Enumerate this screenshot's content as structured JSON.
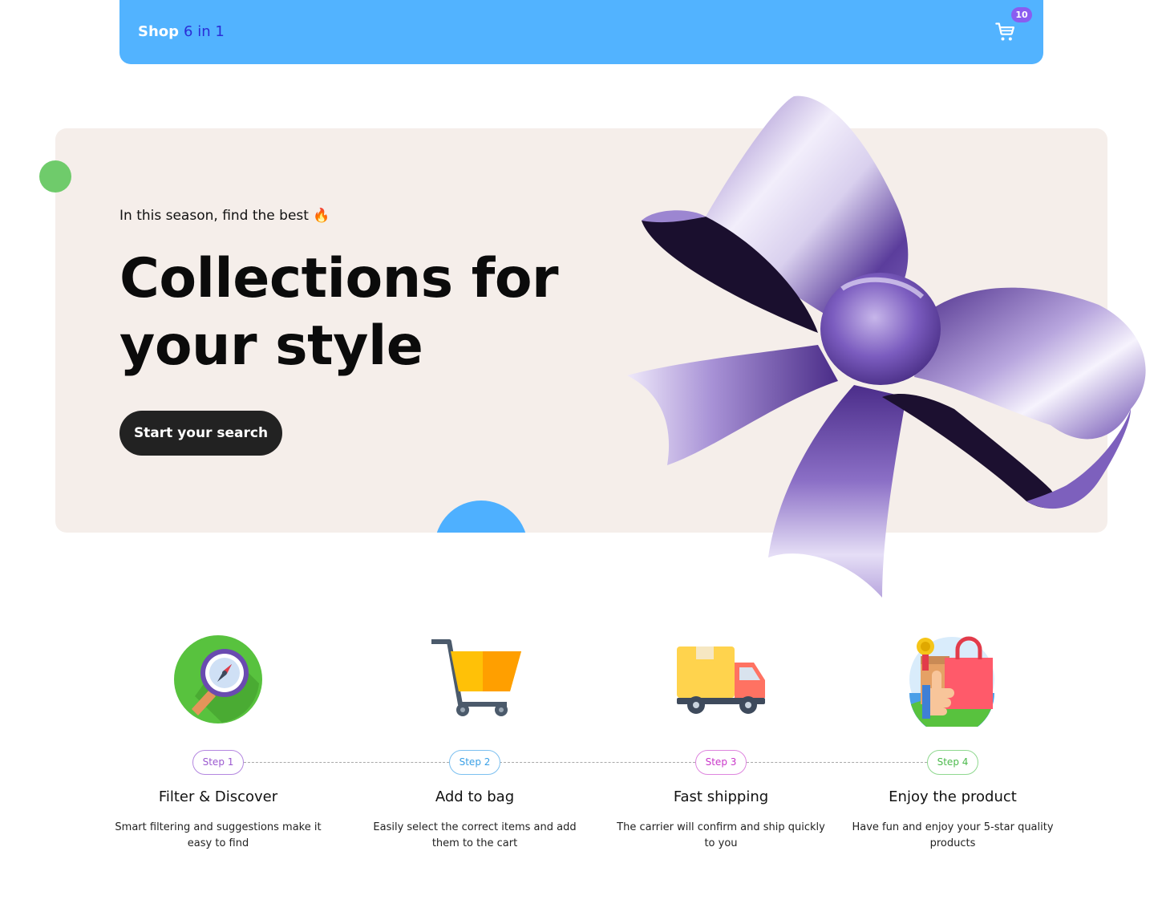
{
  "header": {
    "brand_primary": "Shop",
    "brand_secondary": "6 in 1",
    "cart_count": "10",
    "cart_icon": "cart-icon",
    "colors": {
      "bar": "#52b3ff",
      "brand_secondary": "#2b2fd6",
      "badge": "#8a5cf0"
    }
  },
  "hero": {
    "eyebrow": "In this season, find the best 🔥",
    "headline": "Collections for your style",
    "cta_label": "Start your search",
    "decoration": "purple-ribbon-bow",
    "colors": {
      "background": "#f5eeea",
      "cta": "#222222",
      "accent_blue": "#4eb0ff",
      "accent_green": "#6fcb6b"
    }
  },
  "steps": [
    {
      "badge": "Step 1",
      "title": "Filter & Discover",
      "description": "Smart filtering and suggestions make it easy to find",
      "icon": "magnifier-compass-icon",
      "color": "#9b59d0"
    },
    {
      "badge": "Step 2",
      "title": "Add to bag",
      "description": "Easily select the correct items and add them to the cart",
      "icon": "shopping-cart-icon",
      "color": "#3aa0e6"
    },
    {
      "badge": "Step 3",
      "title": "Fast shipping",
      "description": "The carrier will confirm and ship quickly to you",
      "icon": "delivery-truck-icon",
      "color": "#c936c9"
    },
    {
      "badge": "Step 4",
      "title": "Enjoy the product",
      "description": "Have fun and enjoy your 5-star quality products",
      "icon": "shopping-bag-thumbs-up-icon",
      "color": "#4cba4c"
    }
  ]
}
